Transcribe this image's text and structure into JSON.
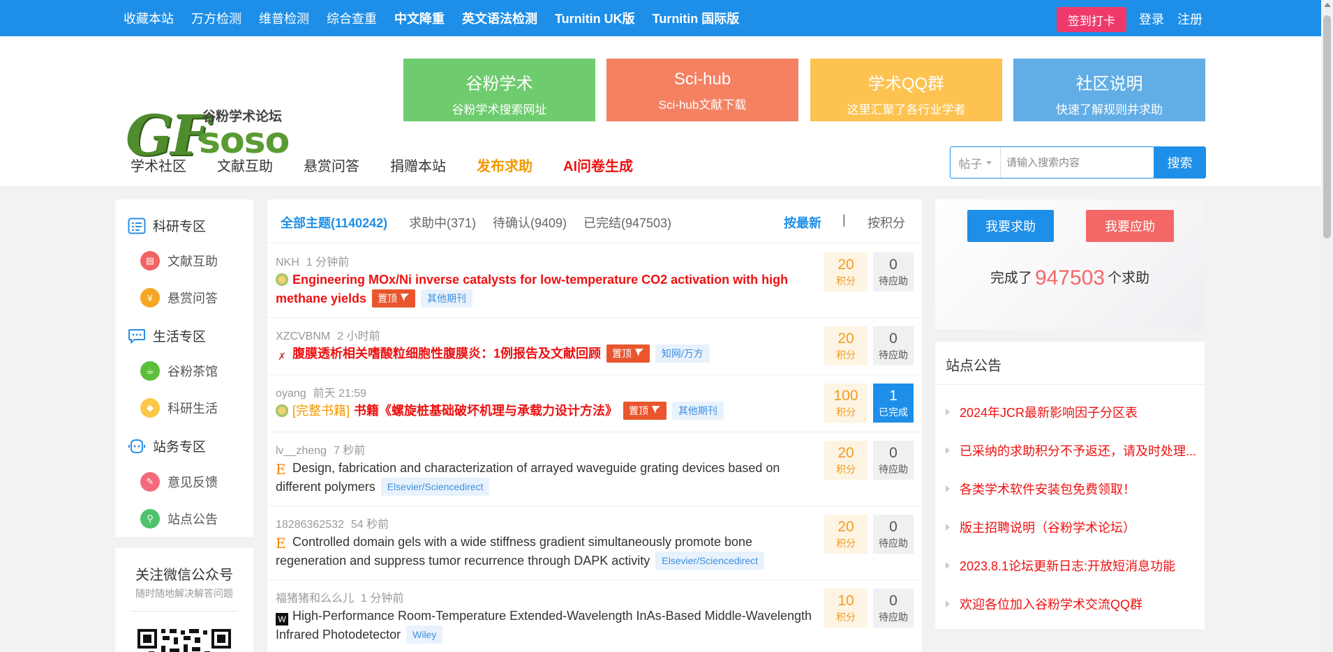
{
  "topnav": {
    "links": [
      "收藏本站",
      "万方检测",
      "维普检测",
      "综合查重",
      "中文降重",
      "英文语法检测",
      "Turnitin UK版",
      "Turnitin 国际版"
    ],
    "checkin": "签到打卡",
    "login": "登录",
    "register": "注册"
  },
  "logo": {
    "gf": "GF",
    "soso": "soso",
    "subtitle": "谷粉学术论坛"
  },
  "banners": [
    {
      "title": "谷粉学术",
      "sub": "谷粉学术搜索网址",
      "color": "#6ecb6e"
    },
    {
      "title": "Sci-hub",
      "sub": "Sci-hub文献下载",
      "color": "#f38162"
    },
    {
      "title": "学术QQ群",
      "sub": "这里汇聚了各行业学者",
      "color": "#fdc250"
    },
    {
      "title": "社区说明",
      "sub": "快速了解规则并求助",
      "color": "#62ade6"
    }
  ],
  "mainnav": [
    "学术社区",
    "文献互助",
    "悬赏问答",
    "捐赠本站",
    "发布求助",
    "AI问卷生成"
  ],
  "search": {
    "type": "帖子",
    "placeholder": "请输入搜索内容",
    "button": "搜索"
  },
  "sidebar": {
    "sections": [
      {
        "label": "科研专区",
        "items": [
          "文献互助",
          "悬赏问答"
        ]
      },
      {
        "label": "生活专区",
        "items": [
          "谷粉茶馆",
          "科研生活"
        ]
      },
      {
        "label": "站务专区",
        "items": [
          "意见反馈",
          "站点公告"
        ]
      }
    ],
    "wechat_title": "关注微信公众号",
    "wechat_sub": "随时随地解决解答问题"
  },
  "tabs": {
    "all": "全部主题(1140242)",
    "seeking": "求助中(371)",
    "pending": "待确认(9409)",
    "done": "已完结(947503)",
    "sort_new": "按最新",
    "sep": "|",
    "sort_score": "按积分"
  },
  "posts": [
    {
      "author": "NKH",
      "time": "1 分钟前",
      "prefix": "",
      "title": "Engineering MOx/Ni inverse catalysts for low-temperature CO2 activation with high methane yields",
      "pinned": "置顶",
      "source": "其他期刊",
      "score": "20",
      "score_label": "积分",
      "resp": "0",
      "resp_label": "待应助",
      "red": true,
      "done": false
    },
    {
      "author": "XZCVBNM",
      "time": "2 小时前",
      "prefix": "",
      "title": "腹膜透析相关嗜酸粒细胞性腹膜炎：1例报告及文献回顾",
      "pinned": "置顶",
      "source": "知网/万方",
      "score": "20",
      "score_label": "积分",
      "resp": "0",
      "resp_label": "待应助",
      "red": true,
      "done": false
    },
    {
      "author": "oyang",
      "time": "前天 21:59",
      "prefix": "[完整书籍]",
      "title": "书籍《螺旋桩基础破坏机理与承载力设计方法》",
      "pinned": "置顶",
      "source": "其他期刊",
      "score": "100",
      "score_label": "积分",
      "resp": "1",
      "resp_label": "已完成",
      "red": true,
      "done": true
    },
    {
      "author": "lv__zheng",
      "time": "7 秒前",
      "prefix": "",
      "title": "Design, fabrication and characterization of arrayed waveguide grating devices based on different polymers",
      "pinned": "",
      "source": "Elsevier/Sciencedirect",
      "score": "20",
      "score_label": "积分",
      "resp": "0",
      "resp_label": "待应助",
      "red": false,
      "done": false
    },
    {
      "author": "18286362532",
      "time": "54 秒前",
      "prefix": "",
      "title": "Controlled domain gels with a wide stiffness gradient simultaneously promote bone regeneration and suppress tumor recurrence through DAPK activity",
      "pinned": "",
      "source": "Elsevier/Sciencedirect",
      "score": "20",
      "score_label": "积分",
      "resp": "0",
      "resp_label": "待应助",
      "red": false,
      "done": false
    },
    {
      "author": "福猪猪和么么儿",
      "time": "1 分钟前",
      "prefix": "",
      "title": "High-Performance Room-Temperature Extended-Wavelength InAs-Based Middle-Wavelength Infrared Photodetector",
      "pinned": "",
      "source": "Wiley",
      "score": "10",
      "score_label": "积分",
      "resp": "0",
      "resp_label": "待应助",
      "red": false,
      "done": false
    }
  ],
  "right": {
    "ask": "我要求助",
    "answer": "我要应助",
    "done_prefix": "完成了",
    "done_count": "947503",
    "done_suffix": "个求助"
  },
  "notice": {
    "title": "站点公告",
    "items": [
      "2024年JCR最新影响因子分区表",
      "已采纳的求助积分不予返还，请及时处理...",
      "各类学术软件安装包免费领取！",
      "版主招聘说明（谷粉学术论坛）",
      "2023.8.1论坛更新日志:开放短消息功能",
      "欢迎各位加入谷粉学术交流QQ群"
    ]
  }
}
